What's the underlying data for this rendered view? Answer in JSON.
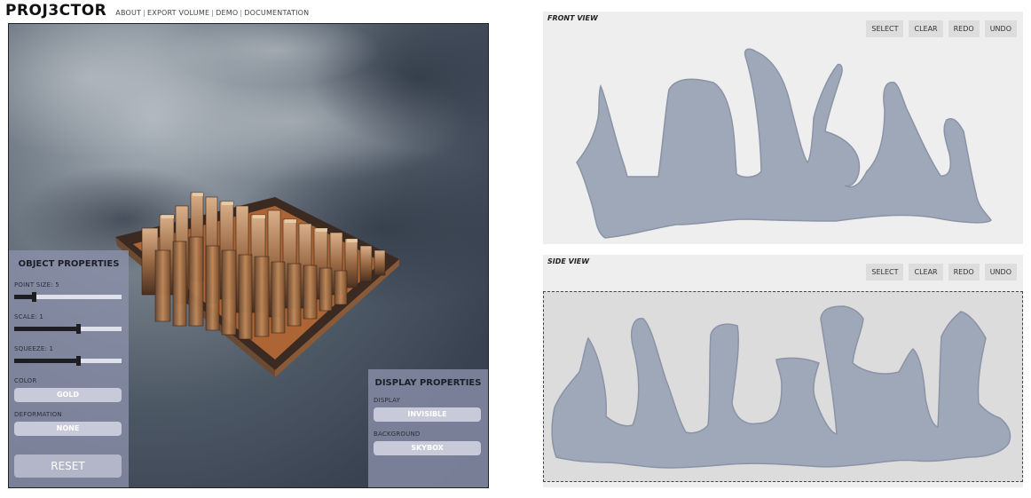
{
  "header": {
    "logo": "PROJ3CTOR",
    "nav": [
      {
        "label": "ABOUT"
      },
      {
        "label": "EXPORT VOLUME"
      },
      {
        "label": "DEMO"
      },
      {
        "label": "DOCUMENTATION"
      }
    ],
    "separator": "|"
  },
  "object_properties": {
    "title": "OBJECT PROPERTIES",
    "point_size": {
      "label": "POINT SIZE: 5",
      "value": 5,
      "fraction": 0.17
    },
    "scale": {
      "label": "SCALE: 1",
      "value": 1,
      "fraction": 0.6
    },
    "squeeze": {
      "label": "SQUEEZE: 1",
      "value": 1,
      "fraction": 0.6
    },
    "color": {
      "label": "COLOR",
      "value": "GOLD"
    },
    "deformation": {
      "label": "DEFORMATION",
      "value": "NONE"
    },
    "reset_label": "RESET"
  },
  "display_properties": {
    "title": "DISPLAY PROPERTIES",
    "display": {
      "label": "DISPLAY",
      "value": "INVISIBLE"
    },
    "background": {
      "label": "BACKGROUND",
      "value": "SKYBOX"
    }
  },
  "front_view": {
    "title": "FRONT VIEW",
    "tools": [
      "SELECT",
      "CLEAR",
      "REDO",
      "UNDO"
    ]
  },
  "side_view": {
    "title": "SIDE VIEW",
    "tools": [
      "SELECT",
      "CLEAR",
      "REDO",
      "UNDO"
    ]
  },
  "colors": {
    "shape_fill": "#9ea8b8",
    "shape_stroke": "#8a94a6",
    "panel": "#8c91aa",
    "tool_bg": "#dddddd"
  }
}
